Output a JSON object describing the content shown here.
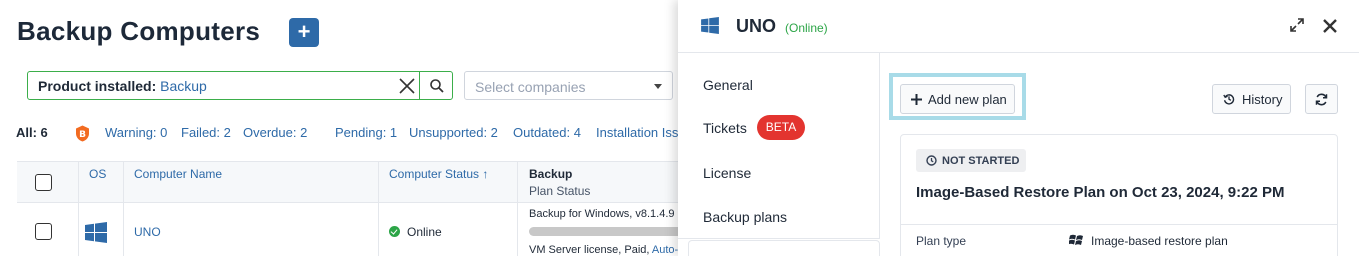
{
  "page": {
    "title": "Backup Computers",
    "add_button_label": "+"
  },
  "search": {
    "label": "Product installed:",
    "value": "Backup"
  },
  "company_select": {
    "placeholder": "Select companies"
  },
  "filters": {
    "all": "All: 6",
    "warning": "Warning: 0",
    "failed": "Failed: 2",
    "overdue": "Overdue: 2",
    "pending": "Pending: 1",
    "unsupported": "Unsupported: 2",
    "outdated": "Outdated: 4",
    "installation": "Installation Iss"
  },
  "table": {
    "headers": {
      "os": "OS",
      "computer_name": "Computer Name",
      "computer_status": "Computer Status ↑",
      "backup": "Backup",
      "plan_status": "Plan Status"
    },
    "rows": [
      {
        "os_icon": "windows-icon",
        "name": "UNO",
        "status": "Online",
        "backup_line": "Backup for Windows, v8.1.4.9",
        "license_line": "VM Server license, Paid,",
        "license_link": "Auto-",
        "progress": 0
      }
    ]
  },
  "panel": {
    "title": "UNO",
    "state": "(Online)",
    "nav": {
      "general": "General",
      "tickets": "Tickets",
      "beta": "BETA",
      "license": "License",
      "backup_plans": "Backup plans"
    },
    "add_plan_label": "Add new plan",
    "history_label": "History",
    "plan": {
      "status": "NOT STARTED",
      "title": "Image-Based Restore Plan on Oct 23, 2024, 9:22 PM",
      "type_label": "Plan type",
      "type_value": "Image-based restore plan"
    }
  },
  "colors": {
    "accent": "#2e6aa8",
    "online": "#2ca547",
    "beta": "#e3342f",
    "highlight": "#a8dbe8"
  }
}
